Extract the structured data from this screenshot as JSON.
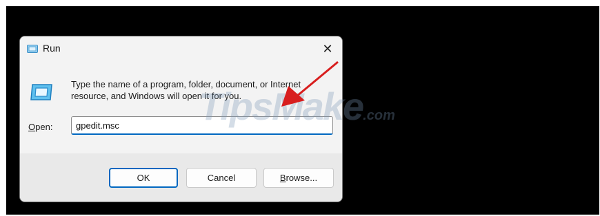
{
  "dialog": {
    "title": "Run",
    "close_glyph": "✕",
    "description": "Type the name of a program, folder, document, or Internet resource, and Windows will open it for you.",
    "open_label_prefix": "",
    "open_label_accel": "O",
    "open_label_rest": "pen:",
    "open_value": "gpedit.msc"
  },
  "buttons": {
    "ok": "OK",
    "cancel": "Cancel",
    "browse_accel": "B",
    "browse_rest": "rowse..."
  },
  "watermark": {
    "main": "TipsMake",
    "suffix": ".com"
  },
  "icons": {
    "title": "run-icon",
    "app": "run-app-icon",
    "close": "close-icon"
  },
  "colors": {
    "accent": "#0067c0",
    "arrow": "#d81e1e",
    "background": "#000000"
  }
}
